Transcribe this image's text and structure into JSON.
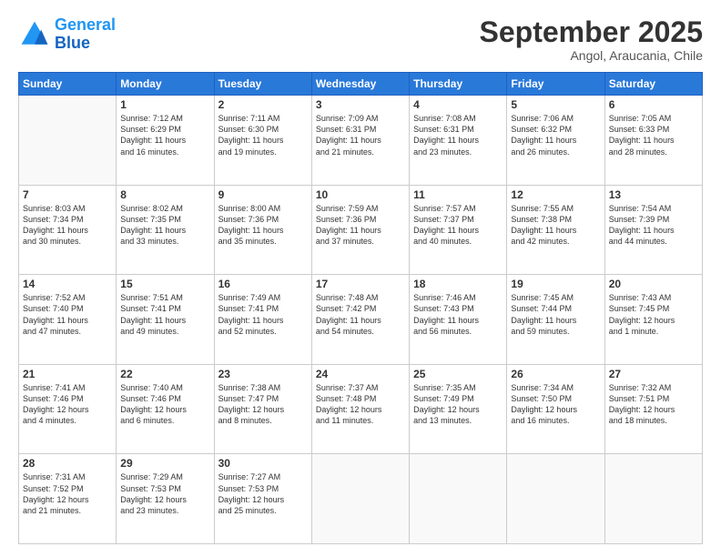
{
  "logo": {
    "line1": "General",
    "line2": "Blue"
  },
  "title": "September 2025",
  "location": "Angol, Araucania, Chile",
  "days_of_week": [
    "Sunday",
    "Monday",
    "Tuesday",
    "Wednesday",
    "Thursday",
    "Friday",
    "Saturday"
  ],
  "weeks": [
    [
      {
        "day": "",
        "info": ""
      },
      {
        "day": "1",
        "info": "Sunrise: 7:12 AM\nSunset: 6:29 PM\nDaylight: 11 hours\nand 16 minutes."
      },
      {
        "day": "2",
        "info": "Sunrise: 7:11 AM\nSunset: 6:30 PM\nDaylight: 11 hours\nand 19 minutes."
      },
      {
        "day": "3",
        "info": "Sunrise: 7:09 AM\nSunset: 6:31 PM\nDaylight: 11 hours\nand 21 minutes."
      },
      {
        "day": "4",
        "info": "Sunrise: 7:08 AM\nSunset: 6:31 PM\nDaylight: 11 hours\nand 23 minutes."
      },
      {
        "day": "5",
        "info": "Sunrise: 7:06 AM\nSunset: 6:32 PM\nDaylight: 11 hours\nand 26 minutes."
      },
      {
        "day": "6",
        "info": "Sunrise: 7:05 AM\nSunset: 6:33 PM\nDaylight: 11 hours\nand 28 minutes."
      }
    ],
    [
      {
        "day": "7",
        "info": "Sunrise: 8:03 AM\nSunset: 7:34 PM\nDaylight: 11 hours\nand 30 minutes."
      },
      {
        "day": "8",
        "info": "Sunrise: 8:02 AM\nSunset: 7:35 PM\nDaylight: 11 hours\nand 33 minutes."
      },
      {
        "day": "9",
        "info": "Sunrise: 8:00 AM\nSunset: 7:36 PM\nDaylight: 11 hours\nand 35 minutes."
      },
      {
        "day": "10",
        "info": "Sunrise: 7:59 AM\nSunset: 7:36 PM\nDaylight: 11 hours\nand 37 minutes."
      },
      {
        "day": "11",
        "info": "Sunrise: 7:57 AM\nSunset: 7:37 PM\nDaylight: 11 hours\nand 40 minutes."
      },
      {
        "day": "12",
        "info": "Sunrise: 7:55 AM\nSunset: 7:38 PM\nDaylight: 11 hours\nand 42 minutes."
      },
      {
        "day": "13",
        "info": "Sunrise: 7:54 AM\nSunset: 7:39 PM\nDaylight: 11 hours\nand 44 minutes."
      }
    ],
    [
      {
        "day": "14",
        "info": "Sunrise: 7:52 AM\nSunset: 7:40 PM\nDaylight: 11 hours\nand 47 minutes."
      },
      {
        "day": "15",
        "info": "Sunrise: 7:51 AM\nSunset: 7:41 PM\nDaylight: 11 hours\nand 49 minutes."
      },
      {
        "day": "16",
        "info": "Sunrise: 7:49 AM\nSunset: 7:41 PM\nDaylight: 11 hours\nand 52 minutes."
      },
      {
        "day": "17",
        "info": "Sunrise: 7:48 AM\nSunset: 7:42 PM\nDaylight: 11 hours\nand 54 minutes."
      },
      {
        "day": "18",
        "info": "Sunrise: 7:46 AM\nSunset: 7:43 PM\nDaylight: 11 hours\nand 56 minutes."
      },
      {
        "day": "19",
        "info": "Sunrise: 7:45 AM\nSunset: 7:44 PM\nDaylight: 11 hours\nand 59 minutes."
      },
      {
        "day": "20",
        "info": "Sunrise: 7:43 AM\nSunset: 7:45 PM\nDaylight: 12 hours\nand 1 minute."
      }
    ],
    [
      {
        "day": "21",
        "info": "Sunrise: 7:41 AM\nSunset: 7:46 PM\nDaylight: 12 hours\nand 4 minutes."
      },
      {
        "day": "22",
        "info": "Sunrise: 7:40 AM\nSunset: 7:46 PM\nDaylight: 12 hours\nand 6 minutes."
      },
      {
        "day": "23",
        "info": "Sunrise: 7:38 AM\nSunset: 7:47 PM\nDaylight: 12 hours\nand 8 minutes."
      },
      {
        "day": "24",
        "info": "Sunrise: 7:37 AM\nSunset: 7:48 PM\nDaylight: 12 hours\nand 11 minutes."
      },
      {
        "day": "25",
        "info": "Sunrise: 7:35 AM\nSunset: 7:49 PM\nDaylight: 12 hours\nand 13 minutes."
      },
      {
        "day": "26",
        "info": "Sunrise: 7:34 AM\nSunset: 7:50 PM\nDaylight: 12 hours\nand 16 minutes."
      },
      {
        "day": "27",
        "info": "Sunrise: 7:32 AM\nSunset: 7:51 PM\nDaylight: 12 hours\nand 18 minutes."
      }
    ],
    [
      {
        "day": "28",
        "info": "Sunrise: 7:31 AM\nSunset: 7:52 PM\nDaylight: 12 hours\nand 21 minutes."
      },
      {
        "day": "29",
        "info": "Sunrise: 7:29 AM\nSunset: 7:53 PM\nDaylight: 12 hours\nand 23 minutes."
      },
      {
        "day": "30",
        "info": "Sunrise: 7:27 AM\nSunset: 7:53 PM\nDaylight: 12 hours\nand 25 minutes."
      },
      {
        "day": "",
        "info": ""
      },
      {
        "day": "",
        "info": ""
      },
      {
        "day": "",
        "info": ""
      },
      {
        "day": "",
        "info": ""
      }
    ]
  ]
}
